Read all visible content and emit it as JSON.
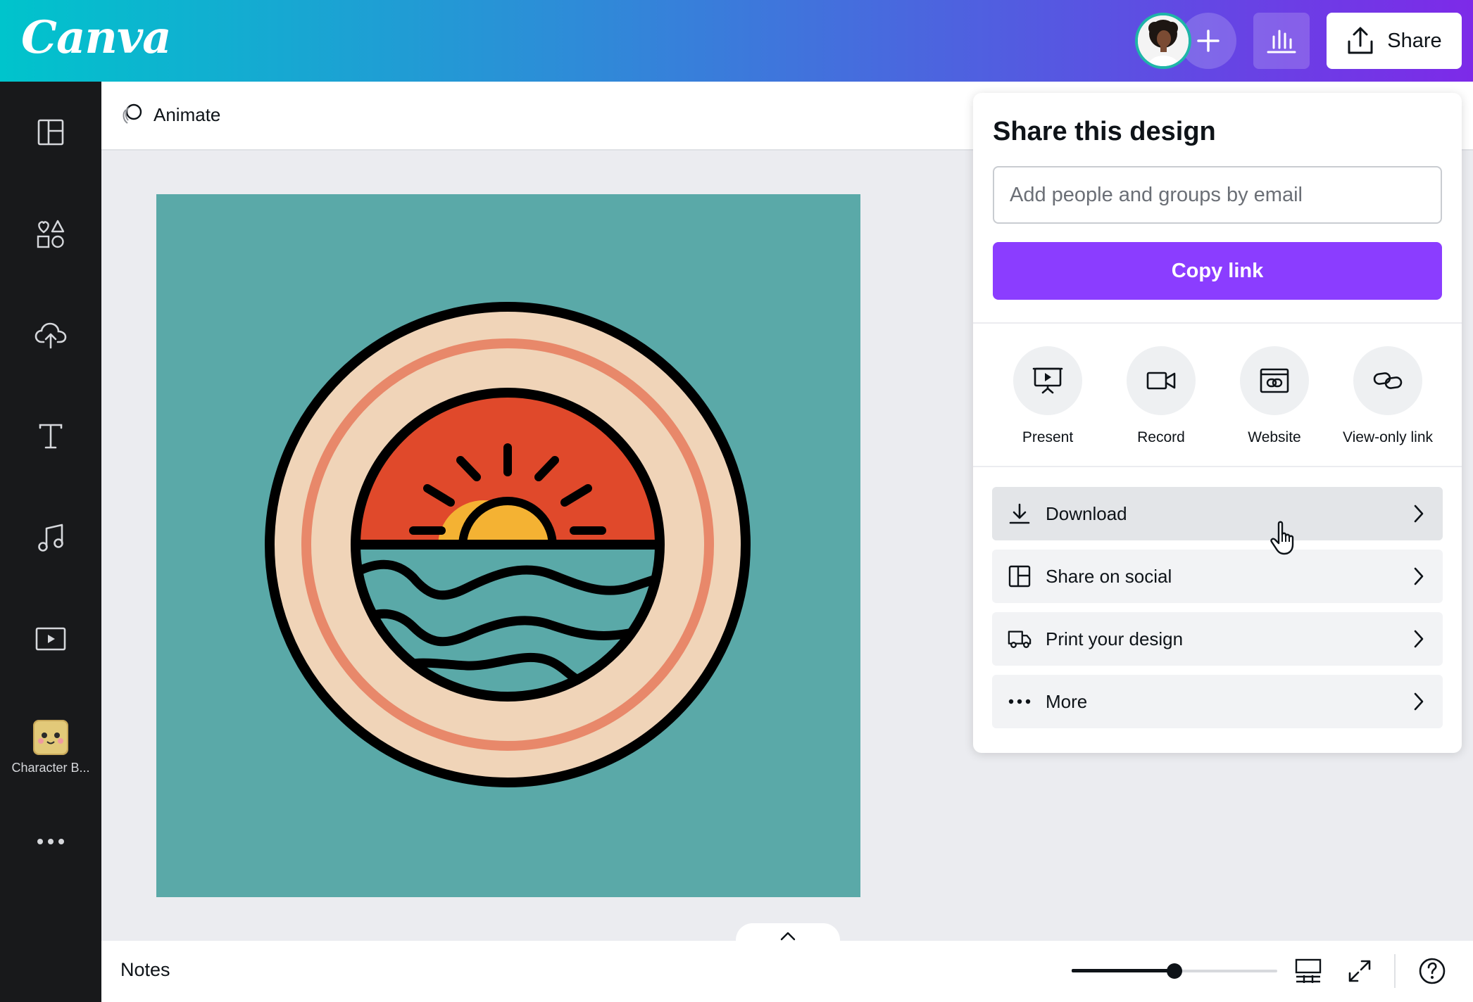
{
  "app": {
    "logo_text": "Canva",
    "share_label": "Share"
  },
  "toolbar": {
    "animate_label": "Animate"
  },
  "sidebar": {
    "items": [
      {
        "icon": "templates-icon"
      },
      {
        "icon": "elements-icon"
      },
      {
        "icon": "uploads-icon"
      },
      {
        "icon": "text-icon"
      },
      {
        "icon": "audio-icon"
      },
      {
        "icon": "videos-icon"
      },
      {
        "icon": "character-builder-icon",
        "label": "Character B..."
      },
      {
        "icon": "more-icon"
      }
    ]
  },
  "share_panel": {
    "title": "Share this design",
    "email_placeholder": "Add people and groups by email",
    "copy_link_label": "Copy link",
    "options": [
      {
        "label": "Present",
        "icon": "present-icon"
      },
      {
        "label": "Record",
        "icon": "record-icon"
      },
      {
        "label": "Website",
        "icon": "website-icon"
      },
      {
        "label": "View-only link",
        "icon": "link-icon"
      }
    ],
    "rows": [
      {
        "label": "Download",
        "icon": "download-icon"
      },
      {
        "label": "Share on social",
        "icon": "share-social-icon"
      },
      {
        "label": "Print your design",
        "icon": "truck-icon"
      },
      {
        "label": "More",
        "icon": "ellipsis-icon"
      }
    ]
  },
  "bottombar": {
    "notes_label": "Notes",
    "zoom_fraction": 0.5
  },
  "colors": {
    "brand_purple": "#8b3dff",
    "design_background": "#5aa9a8",
    "sunset_red": "#e0492b",
    "sun_yellow": "#f4b233",
    "ring_cream": "#f0d4b8",
    "ring_salmon": "#e8886a"
  }
}
